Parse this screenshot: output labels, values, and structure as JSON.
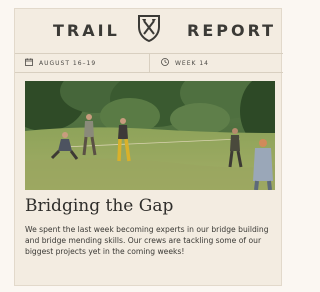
{
  "masthead": {
    "left_word": "TRAIL",
    "right_word": "REPORT",
    "logo_icon": "crossed-axes-shield-icon"
  },
  "meta": {
    "date_icon": "calendar-icon",
    "date": "AUGUST 16–19",
    "week_icon": "clock-icon",
    "week": "WEEK 14"
  },
  "photo": {
    "description_icon": "trail-crew-photo"
  },
  "article": {
    "headline": "Bridging the Gap",
    "body": "We spent the last week becoming experts in our bridge building and bridge mending skills. Our crews are tackling some of our biggest projects yet in the coming weeks!"
  },
  "colors": {
    "card_bg": "#f3ece1",
    "text": "#2f2e2b",
    "divider": "#d8cfc0"
  }
}
